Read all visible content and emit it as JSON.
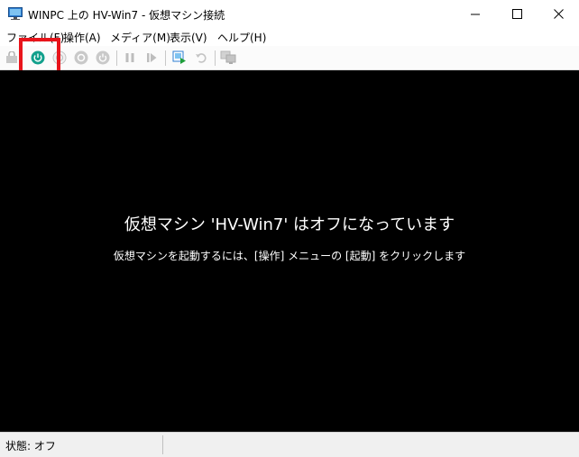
{
  "window": {
    "title": "WINPC 上の HV-Win7 - 仮想マシン接続",
    "minimize_icon": "minimize-icon",
    "maximize_icon": "maximize-icon",
    "close_icon": "close-icon"
  },
  "menu": {
    "items": [
      {
        "label": "ファイル(F)"
      },
      {
        "label": "操作(A)"
      },
      {
        "label": "メディア(M)"
      },
      {
        "label": "表示(V)"
      },
      {
        "label": "ヘルプ(H)"
      }
    ]
  },
  "toolbar": {
    "icons": [
      "ctrl-alt-del-icon",
      "start-icon",
      "turn-off-icon",
      "shut-down-icon",
      "save-icon",
      "pause-icon",
      "reset-icon",
      "checkpoint-icon",
      "revert-icon",
      "enhanced-session-icon"
    ],
    "highlight_color": "#e8141b",
    "start_color": "#12a08c"
  },
  "screen": {
    "title": "仮想マシン 'HV-Win7' はオフになっています",
    "subtitle": "仮想マシンを起動するには、[操作] メニューの [起動] をクリックします"
  },
  "status": {
    "text": "状態: オフ"
  }
}
